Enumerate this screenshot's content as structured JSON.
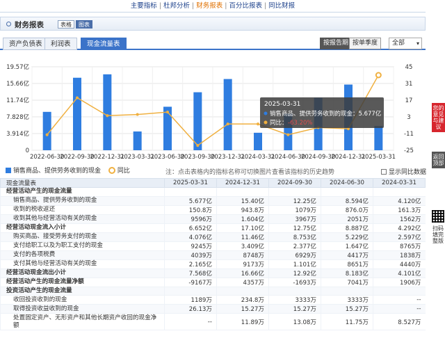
{
  "topnav": [
    "主要指标",
    "杜邦分析",
    "财务报表",
    "百分比报表",
    "同比财报"
  ],
  "topnav_active": 2,
  "panel": {
    "title": "财务报表",
    "tag_table": "表格",
    "tag_chart": "图表"
  },
  "tabs": [
    "资产负债表",
    "利润表",
    "现金流量表"
  ],
  "tabs_active": 2,
  "period_buttons": [
    "按报告期",
    "按单季度"
  ],
  "period_active": 0,
  "range_select": "全部",
  "chart_data": {
    "type": "bar",
    "categories": [
      "2022-06-30",
      "2022-09-30",
      "2022-12-31",
      "2023-03-31",
      "2023-06-30",
      "2023-09-30",
      "2023-12-31",
      "2024-03-31",
      "2024-06-30",
      "2024-09-30",
      "2024-12-31",
      "2025-03-31"
    ],
    "series": [
      {
        "name": "销售商品、提供劳务收到的现金",
        "axis": "left",
        "values": [
          9.0,
          17.0,
          17.8,
          4.4,
          10.2,
          13.6,
          16.7,
          4.1,
          8.6,
          12.3,
          15.4,
          5.677
        ]
      },
      {
        "name": "同比",
        "axis": "right",
        "values": [
          -12,
          19,
          4,
          5,
          7,
          -21,
          -3,
          -3,
          -12,
          -6,
          -7,
          38
        ]
      }
    ],
    "yticks_left": [
      "19.57亿",
      "15.66亿",
      "11.74亿",
      "7.828亿",
      "3.914亿",
      "0"
    ],
    "yticks_right": [
      "45",
      "31",
      "17",
      "3",
      "-11",
      "-25"
    ],
    "ylim_left": [
      0,
      19.57
    ],
    "ylim_right": [
      -25,
      45
    ],
    "colors": {
      "bar": "#2f7de0",
      "line": "#f0b040",
      "highlight": "#f0b040"
    },
    "tooltip": {
      "date": "2025-03-31",
      "label1": "销售商品、提供劳务收到的现金：",
      "value1": "5.677亿",
      "label2": "同比：",
      "value2": "-63.20%"
    }
  },
  "legend": {
    "bar": "销售商品、提供劳务收到的现金",
    "line": "同比"
  },
  "note": "注：点击表格内的指标名称可切换图片查看该指标的历史趋势",
  "checkbox": "显示同比数据",
  "table": {
    "headers": [
      "现金流量表",
      "2025-03-31",
      "2024-12-31",
      "2024-09-30",
      "2024-06-30",
      "2024-03-31"
    ],
    "rows": [
      {
        "label": "经营活动产生的现金流量",
        "section": true,
        "cells": [
          "",
          "",
          "",
          "",
          ""
        ]
      },
      {
        "label": "销售商品、提供劳务收到的现金",
        "cells": [
          "5.677亿",
          "15.40亿",
          "12.25亿",
          "8.594亿",
          "4.120亿"
        ]
      },
      {
        "label": "收到的税收返还",
        "cells": [
          "150.8万",
          "943.8万",
          "1079万",
          "876.0万",
          "161.3万"
        ]
      },
      {
        "label": "收到其他与经营活动有关的现金",
        "cells": [
          "9596万",
          "1.604亿",
          "3967万",
          "2051万",
          "1562万"
        ]
      },
      {
        "label": "经营活动现金流入小计",
        "section": true,
        "cells": [
          "6.652亿",
          "17.10亿",
          "12.75亿",
          "8.887亿",
          "4.292亿"
        ]
      },
      {
        "label": "购买商品、接受劳务支付的现金",
        "cells": [
          "4.076亿",
          "11.46亿",
          "8.753亿",
          "5.229亿",
          "2.597亿"
        ]
      },
      {
        "label": "支付给职工以及为职工支付的现金",
        "cells": [
          "9245万",
          "3.409亿",
          "2.377亿",
          "1.647亿",
          "8765万"
        ]
      },
      {
        "label": "支付的各项税费",
        "cells": [
          "4039万",
          "8748万",
          "6929万",
          "4417万",
          "1838万"
        ]
      },
      {
        "label": "支付其他与经营活动有关的现金",
        "cells": [
          "2.165亿",
          "9173万",
          "1.101亿",
          "8651万",
          "4440万"
        ]
      },
      {
        "label": "经营活动现金流出小计",
        "section": true,
        "cells": [
          "7.568亿",
          "16.66亿",
          "12.92亿",
          "8.183亿",
          "4.101亿"
        ]
      },
      {
        "label": "经营活动产生的现金流量净额",
        "section": true,
        "cells": [
          "-9167万",
          "4357万",
          "-1693万",
          "7041万",
          "1906万"
        ]
      },
      {
        "label": "投资活动产生的现金流量",
        "section": true,
        "cells": [
          "",
          "",
          "",
          "",
          ""
        ]
      },
      {
        "label": "收回投资收到的现金",
        "cells": [
          "1189万",
          "234.8万",
          "3333万",
          "3333万",
          "--"
        ]
      },
      {
        "label": "取得投资收益收到的现金",
        "cells": [
          "26.13万",
          "15.27万",
          "15.27万",
          "15.27万",
          "--"
        ]
      },
      {
        "label": "处置固定资产、无形资产和其他长期资产收回的现金净额",
        "tall": true,
        "cells": [
          "--",
          "11.89万",
          "13.08万",
          "11.75万",
          "8.527万"
        ]
      }
    ]
  },
  "side": {
    "feedback": "您的意见与建议",
    "top": "返回顶部",
    "qr": "扫码填完整版"
  }
}
